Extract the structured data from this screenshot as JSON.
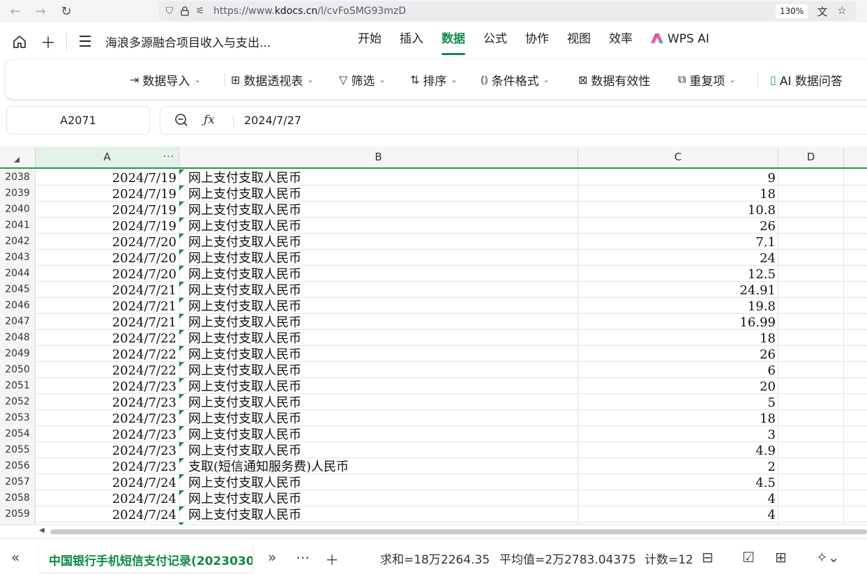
{
  "browser": {
    "url_prefix": "https://www.",
    "url_domain": "kdocs.cn",
    "url_path": "/l/cvFoSMG93mzD",
    "zoom": "130%"
  },
  "header": {
    "doc_title": "海浪多源融合项目收入与支出...",
    "tabs": [
      {
        "label": "开始"
      },
      {
        "label": "插入"
      },
      {
        "label": "数据"
      },
      {
        "label": "公式"
      },
      {
        "label": "协作"
      },
      {
        "label": "视图"
      },
      {
        "label": "效率"
      },
      {
        "label": "WPS AI"
      }
    ]
  },
  "ribbon": {
    "import": "数据导入",
    "pivot": "数据透视表",
    "filter": "筛选",
    "sort": "排序",
    "condformat": "条件格式",
    "validation": "数据有效性",
    "duplicates": "重复项",
    "ai_qa": "AI 数据问答"
  },
  "formula_bar": {
    "cell_ref": "A2071",
    "fx": "ƒx",
    "value": "2024/7/27"
  },
  "grid": {
    "columns": [
      "A",
      "B",
      "C",
      "D"
    ],
    "rows": [
      {
        "num": "2038",
        "a": "2024/7/19",
        "b": "网上支付支取人民币",
        "c": "9"
      },
      {
        "num": "2039",
        "a": "2024/7/19",
        "b": "网上支付支取人民币",
        "c": "18"
      },
      {
        "num": "2040",
        "a": "2024/7/19",
        "b": "网上支付支取人民币",
        "c": "10.8"
      },
      {
        "num": "2041",
        "a": "2024/7/19",
        "b": "网上支付支取人民币",
        "c": "26"
      },
      {
        "num": "2042",
        "a": "2024/7/20",
        "b": "网上支付支取人民币",
        "c": "7.1"
      },
      {
        "num": "2043",
        "a": "2024/7/20",
        "b": "网上支付支取人民币",
        "c": "24"
      },
      {
        "num": "2044",
        "a": "2024/7/20",
        "b": "网上支付支取人民币",
        "c": "12.5"
      },
      {
        "num": "2045",
        "a": "2024/7/21",
        "b": "网上支付支取人民币",
        "c": "24.91"
      },
      {
        "num": "2046",
        "a": "2024/7/21",
        "b": "网上支付支取人民币",
        "c": "19.8"
      },
      {
        "num": "2047",
        "a": "2024/7/21",
        "b": "网上支付支取人民币",
        "c": "16.99"
      },
      {
        "num": "2048",
        "a": "2024/7/22",
        "b": "网上支付支取人民币",
        "c": "18"
      },
      {
        "num": "2049",
        "a": "2024/7/22",
        "b": "网上支付支取人民币",
        "c": "26"
      },
      {
        "num": "2050",
        "a": "2024/7/22",
        "b": "网上支付支取人民币",
        "c": "6"
      },
      {
        "num": "2051",
        "a": "2024/7/23",
        "b": "网上支付支取人民币",
        "c": "20"
      },
      {
        "num": "2052",
        "a": "2024/7/23",
        "b": "网上支付支取人民币",
        "c": "5"
      },
      {
        "num": "2053",
        "a": "2024/7/23",
        "b": "网上支付支取人民币",
        "c": "18"
      },
      {
        "num": "2054",
        "a": "2024/7/23",
        "b": "网上支付支取人民币",
        "c": "3"
      },
      {
        "num": "2055",
        "a": "2024/7/23",
        "b": "网上支付支取人民币",
        "c": "4.9"
      },
      {
        "num": "2056",
        "a": "2024/7/23",
        "b": "支取(短信通知服务费)人民币",
        "c": "2"
      },
      {
        "num": "2057",
        "a": "2024/7/24",
        "b": "网上支付支取人民币",
        "c": "4.5"
      },
      {
        "num": "2058",
        "a": "2024/7/24",
        "b": "网上支付支取人民币",
        "c": "4"
      },
      {
        "num": "2059",
        "a": "2024/7/24",
        "b": "网上支付支取人民币",
        "c": "4"
      },
      {
        "num": "2060",
        "a": "",
        "b": "",
        "c": ""
      }
    ]
  },
  "statusbar": {
    "sheet_name": "中国银行手机短信支付记录(2023030",
    "sum": "求和=18万2264.35",
    "avg": "平均值=2万2783.04375",
    "count": "计数=12"
  }
}
